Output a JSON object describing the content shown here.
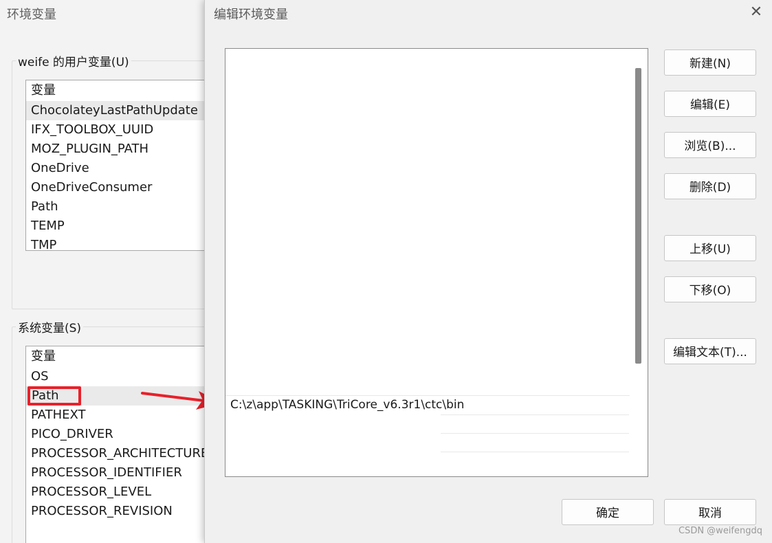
{
  "background_window": {
    "title": "环境变量",
    "user_vars": {
      "label": "weife 的用户变量(U)",
      "header": "变量",
      "items": [
        "ChocolateyLastPathUpdate",
        "IFX_TOOLBOX_UUID",
        "MOZ_PLUGIN_PATH",
        "OneDrive",
        "OneDriveConsumer",
        "Path",
        "TEMP",
        "TMP"
      ],
      "selected_index": 0
    },
    "system_vars": {
      "label": "系统变量(S)",
      "header": "变量",
      "items": [
        "OS",
        "Path",
        "PATHEXT",
        "PICO_DRIVER",
        "PROCESSOR_ARCHITECTURE",
        "PROCESSOR_IDENTIFIER",
        "PROCESSOR_LEVEL",
        "PROCESSOR_REVISION"
      ],
      "highlighted_index": 1
    }
  },
  "dialog": {
    "title": "编辑环境变量",
    "close_glyph": "✕",
    "path_entries": [
      "C:\\z\\app\\TASKING\\TriCore_v6.3r1\\ctc\\bin",
      "",
      "",
      ""
    ],
    "buttons": {
      "new": "新建(N)",
      "edit": "编辑(E)",
      "browse": "浏览(B)...",
      "delete": "删除(D)",
      "move_up": "上移(U)",
      "move_down": "下移(O)",
      "edit_text": "编辑文本(T)...",
      "ok": "确定",
      "cancel": "取消"
    }
  },
  "annotation": {
    "arrow_color": "#e8202a",
    "highlight_color": "#e8202a"
  },
  "watermark": "CSDN @weifengdq"
}
